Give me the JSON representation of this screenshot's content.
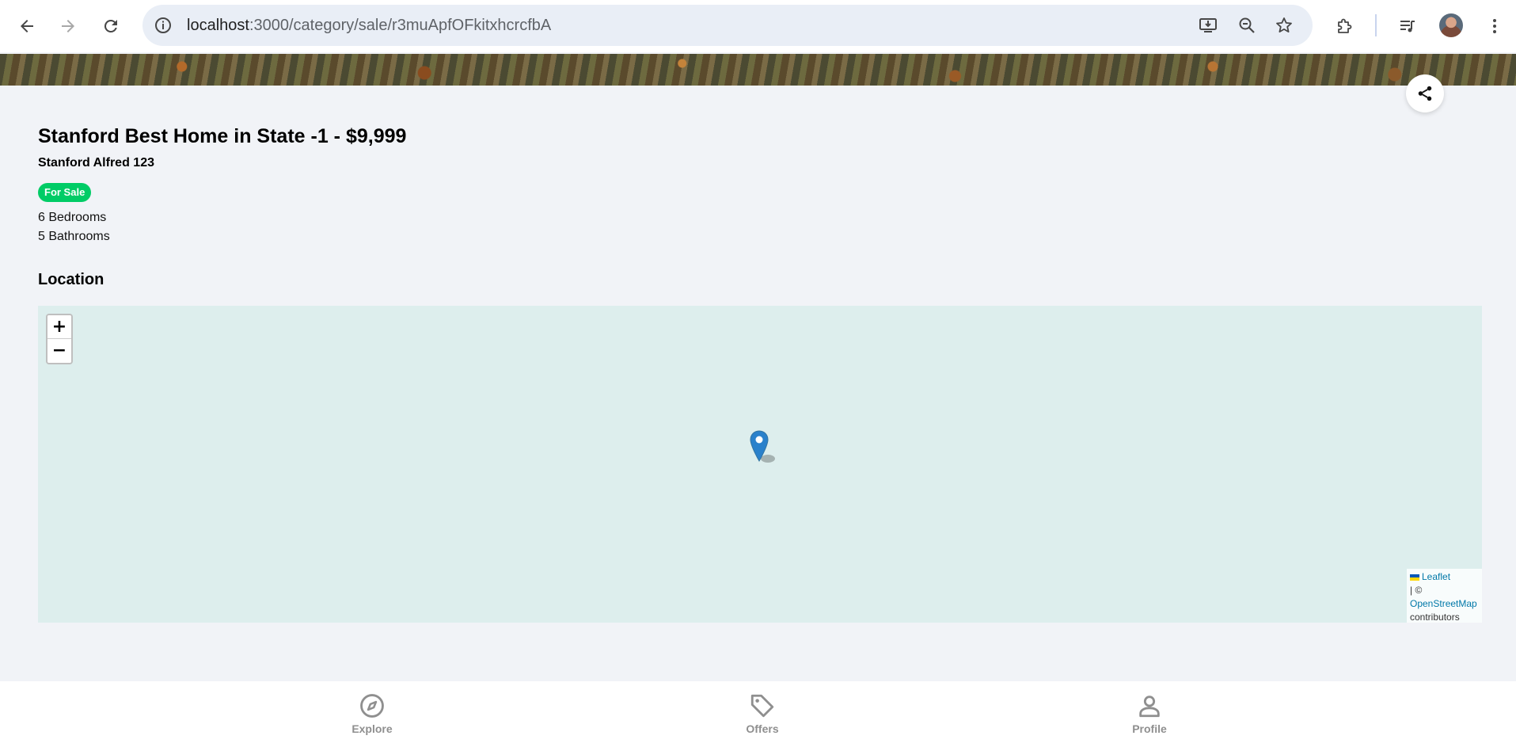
{
  "browser": {
    "url_host": "localhost",
    "url_path": ":3000/category/sale/r3muApfOFkitxhcrcfbA",
    "icons": {
      "back": "arrow-left-icon",
      "forward": "arrow-right-icon",
      "reload": "reload-icon",
      "site_info": "info-icon",
      "install": "install-app-icon",
      "zoom": "zoom-out-icon",
      "bookmark": "star-icon",
      "extensions": "puzzle-icon",
      "media": "media-queue-icon",
      "menu": "kebab-menu-icon"
    }
  },
  "listing": {
    "title": "Stanford Best Home in State -1 - $9,999",
    "address": "Stanford Alfred 123",
    "badge": "For Sale",
    "bedrooms": "6 Bedrooms",
    "bathrooms": "5 Bathrooms",
    "badge_color": "#00cc66"
  },
  "location": {
    "heading": "Location",
    "zoom_in": "+",
    "zoom_out": "−",
    "attribution_leaflet": "Leaflet",
    "attribution_sep": "| ©",
    "attribution_osm": "OpenStreetMap",
    "attribution_contrib": "contributors",
    "map_bg": "#ddeeed",
    "marker_color": "#2a81cb"
  },
  "bottom_nav": {
    "items": [
      {
        "label": "Explore",
        "icon": "compass-icon"
      },
      {
        "label": "Offers",
        "icon": "tag-icon"
      },
      {
        "label": "Profile",
        "icon": "person-icon"
      }
    ]
  }
}
